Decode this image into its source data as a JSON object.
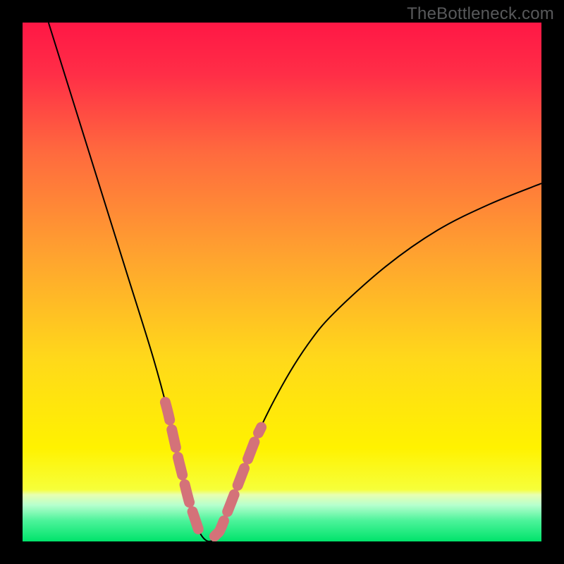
{
  "watermark": "TheBottleneck.com",
  "chart_data": {
    "type": "line",
    "title": "",
    "xlabel": "",
    "ylabel": "",
    "xlim": [
      0,
      100
    ],
    "ylim": [
      0,
      100
    ],
    "series": [
      {
        "name": "bottleneck-curve",
        "color": "#000000",
        "x": [
          5,
          10,
          15,
          20,
          25,
          28,
          30,
          32,
          34,
          36,
          38,
          40,
          45,
          50,
          55,
          60,
          70,
          80,
          90,
          100
        ],
        "y": [
          100,
          84,
          68,
          52,
          36,
          25,
          16,
          8,
          2,
          0,
          2,
          7,
          20,
          30,
          38,
          44,
          53,
          60,
          65,
          69
        ]
      }
    ],
    "highlight_segments": {
      "name": "data-point-markers",
      "color": "#d47279",
      "description": "dashed thick overlay near minimum on both sides",
      "left_x_range": [
        27.5,
        34
      ],
      "right_x_range": [
        37,
        46
      ]
    },
    "gradient_background": {
      "top_color": "#ff1745",
      "mid_color": "#ffe100",
      "bottom_band_color": "#00e36b",
      "bottom_band_start_pct": 91
    }
  }
}
